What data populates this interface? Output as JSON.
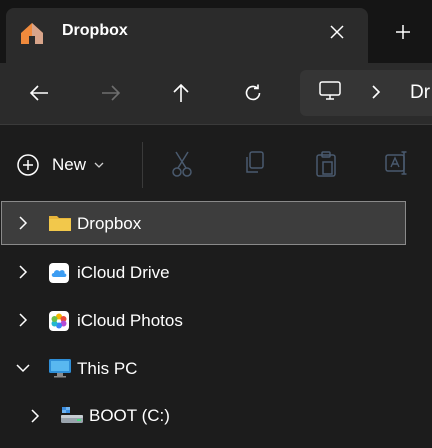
{
  "tab": {
    "title": "Dropbox",
    "home_icon": "home-icon",
    "close_icon": "close-icon",
    "new_tab_icon": "plus-icon"
  },
  "nav": {
    "back_icon": "arrow-left-icon",
    "forward_icon": "arrow-right-icon",
    "up_icon": "arrow-up-icon",
    "refresh_icon": "refresh-icon",
    "address_icon": "monitor-icon",
    "address_text": "Dr"
  },
  "commandbar": {
    "new_label": "New",
    "new_icon": "plus-circle-icon",
    "actions": [
      "cut-icon",
      "copy-icon",
      "paste-icon",
      "rename-icon"
    ]
  },
  "tree": {
    "items": [
      {
        "label": "Dropbox",
        "icon": "folder-icon",
        "expanded": false,
        "selected": true
      },
      {
        "label": "iCloud Drive",
        "icon": "icloud-drive-icon",
        "expanded": false,
        "selected": false
      },
      {
        "label": "iCloud Photos",
        "icon": "icloud-photos-icon",
        "expanded": false,
        "selected": false
      },
      {
        "label": "This PC",
        "icon": "this-pc-icon",
        "expanded": true,
        "selected": false
      },
      {
        "label": "BOOT (C:)",
        "icon": "drive-icon",
        "expanded": false,
        "selected": false
      }
    ]
  },
  "colors": {
    "background": "#1c1c1c",
    "tab": "#2b2b2b",
    "selection": "#3d3d3d",
    "folder": "#f2c84b"
  }
}
